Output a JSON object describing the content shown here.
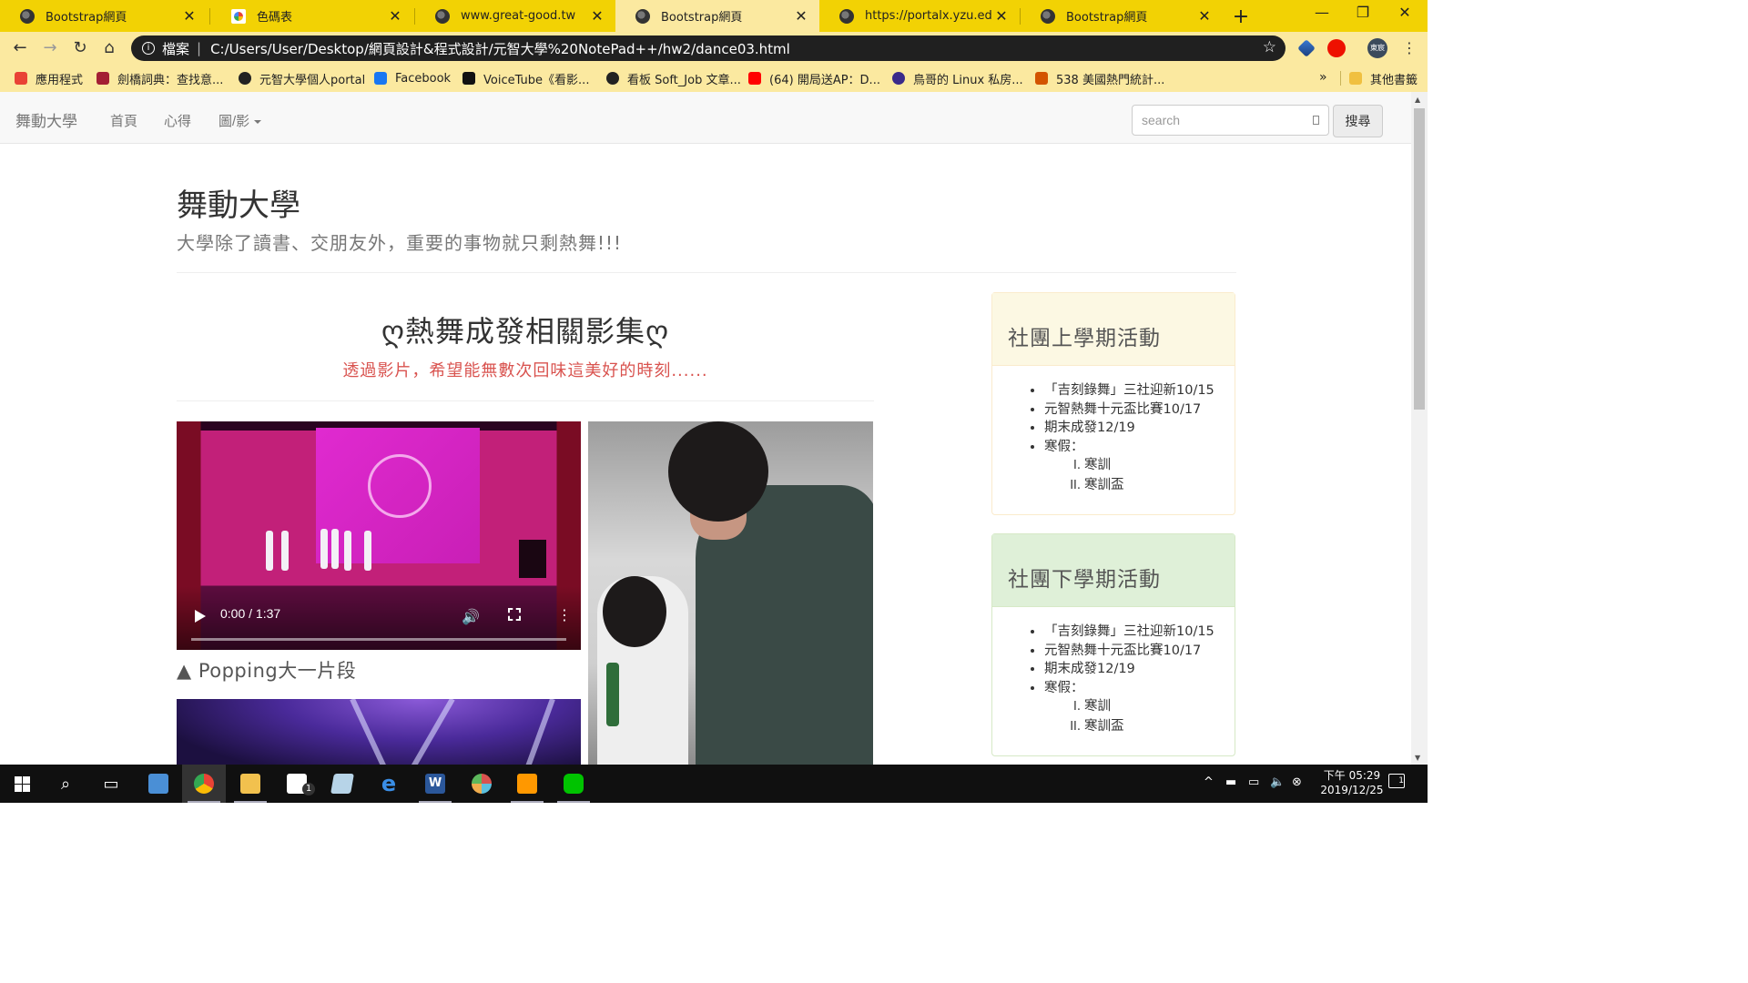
{
  "browser": {
    "tabs": [
      {
        "title": "Bootstrap網頁",
        "icon": "globe-icon",
        "active": false
      },
      {
        "title": "色碼表",
        "icon": "sheet-icon",
        "active": false
      },
      {
        "title": "www.great-good.tw",
        "icon": "globe-icon",
        "active": false
      },
      {
        "title": "Bootstrap網頁",
        "icon": "globe-icon",
        "active": true
      },
      {
        "title": "https://portalx.yzu.edu.tw/",
        "icon": "globe-icon",
        "active": false
      },
      {
        "title": "Bootstrap網頁",
        "icon": "globe-icon",
        "active": false
      }
    ],
    "tab_close": "✕",
    "new_tab": "+",
    "window": {
      "minimize": "—",
      "maximize": "❐",
      "close": "✕"
    },
    "address": {
      "scheme_label": "檔案",
      "url": "C:/Users/User/Desktop/網頁設計&程式設計/元智大學%20NotePad++/hw2/dance03.html"
    },
    "profile_label": "東宸",
    "bookmarks": [
      {
        "label": "應用程式",
        "color": "#e94235"
      },
      {
        "label": "劍橋詞典：查找意...",
        "color": "#a31f34"
      },
      {
        "label": "元智大學個人portal",
        "color": "#222222"
      },
      {
        "label": "Facebook",
        "color": "#1877f2"
      },
      {
        "label": "VoiceTube《看影...",
        "color": "#111111"
      },
      {
        "label": "看板 Soft_Job 文章...",
        "color": "#222222"
      },
      {
        "label": "(64) 開局送AP：D...",
        "color": "#ff0000"
      },
      {
        "label": "鳥哥的 Linux 私房...",
        "color": "#3a2a8a"
      },
      {
        "label": "538 美國熱門統計...",
        "color": "#d35400"
      }
    ],
    "bookmarks_more": "»",
    "other_bookmarks": "其他書籤"
  },
  "page": {
    "navbar": {
      "brand": "舞動大學",
      "links": [
        "首頁",
        "心得",
        "圖/影"
      ],
      "search_placeholder": "search",
      "search_button": "搜尋"
    },
    "header": {
      "title": "舞動大學",
      "subtitle": "大學除了讀書、交朋友外，重要的事物就只剩熱舞!!!"
    },
    "gallery": {
      "title": "ღ熱舞成發相關影集ღ",
      "subtitle": "透過影片，希望能無數次回味這美好的時刻......",
      "video1": {
        "time": "0:00 / 1:37",
        "progress": 0
      },
      "caption1": "▲ Popping大一片段"
    },
    "panels": [
      {
        "title": "社團上學期活動",
        "items": [
          "「吉刻錄舞」三社迎新10/15",
          "元智熱舞十元盃比賽10/17",
          "期末成發12/19",
          "寒假："
        ],
        "subitems": [
          {
            "num": "I.",
            "label": "寒訓"
          },
          {
            "num": "II.",
            "label": "寒訓盃"
          }
        ]
      },
      {
        "title": "社團下學期活動",
        "items": [
          "「吉刻錄舞」三社迎新10/15",
          "元智熱舞十元盃比賽10/17",
          "期末成發12/19",
          "寒假："
        ],
        "subitems": [
          {
            "num": "I.",
            "label": "寒訓"
          },
          {
            "num": "II.",
            "label": "寒訓盃"
          }
        ]
      }
    ]
  },
  "taskbar": {
    "clock_time": "下午 05:29",
    "clock_date": "2019/12/25",
    "mail_badge": "1",
    "notification_count": "1"
  }
}
